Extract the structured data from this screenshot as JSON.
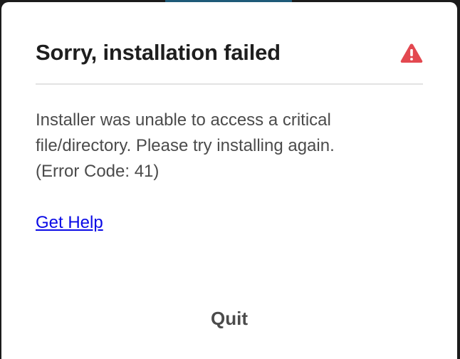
{
  "dialog": {
    "title": "Sorry, installation failed",
    "alert_icon": "alert-triangle-icon",
    "alert_color": "#e34850",
    "message_lines": [
      "Installer was unable to access a critical",
      "file/directory. Please try installing again.",
      "(Error Code: 41)"
    ],
    "help_link": "Get Help",
    "quit_label": "Quit"
  },
  "colors": {
    "title_text": "#1e1e1e",
    "body_text": "#4b4b4b",
    "link": "#0a0ae6",
    "divider": "#e3e3e3",
    "dialog_background": "#ffffff"
  }
}
